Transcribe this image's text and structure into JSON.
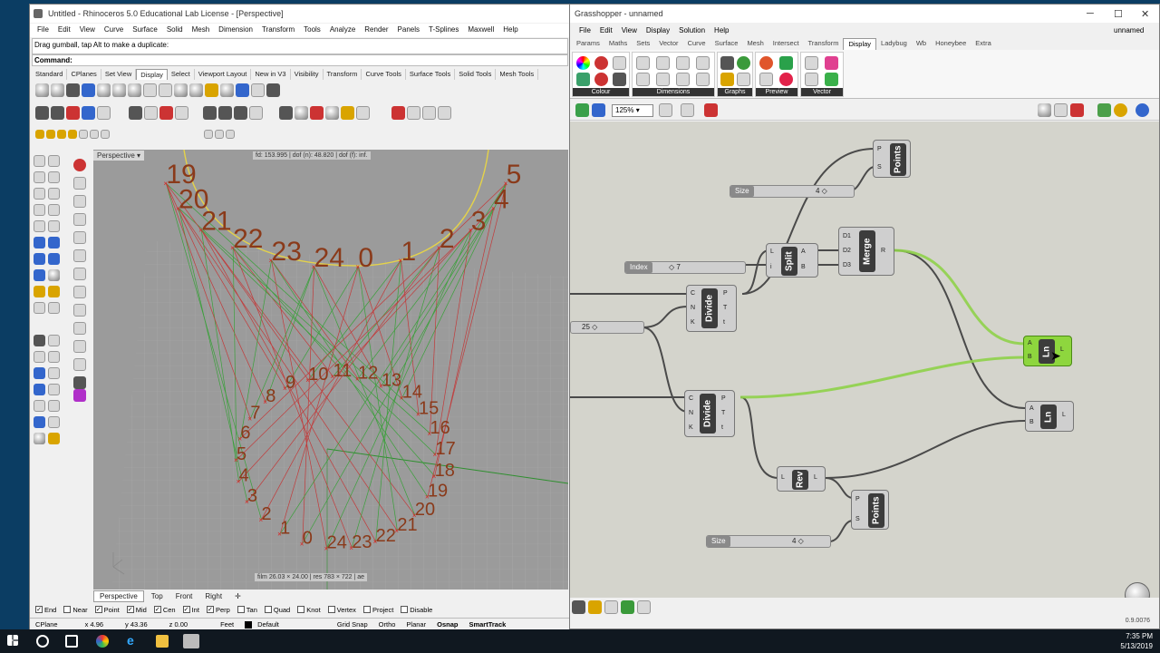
{
  "rhino": {
    "title": "Untitled - Rhinoceros 5.0 Educational Lab License - [Perspective]",
    "menu": [
      "File",
      "Edit",
      "View",
      "Curve",
      "Surface",
      "Solid",
      "Mesh",
      "Dimension",
      "Transform",
      "Tools",
      "Analyze",
      "Render",
      "Panels",
      "T-Splines",
      "Maxwell",
      "Help"
    ],
    "command_history": "Drag gumball, tap Alt to make a duplicate:",
    "command_prompt": "Command:",
    "toolbar_tabs": [
      "Standard",
      "CPlanes",
      "Set View",
      "Display",
      "Select",
      "Viewport Layout",
      "New in V3",
      "Visibility",
      "Transform",
      "Curve Tools",
      "Surface Tools",
      "Solid Tools",
      "Mesh Tools"
    ],
    "active_tab": "Display",
    "viewport_label": "Perspective",
    "camera_info": "fd: 153.995 | dof (n): 48.820 | dof (f): inf.",
    "film_info": "film 26.03 × 24.00 | res 783 × 722 | ae",
    "view_tabs": [
      "Perspective",
      "Top",
      "Front",
      "Right"
    ],
    "osnaps": [
      {
        "label": "End",
        "checked": true
      },
      {
        "label": "Near",
        "checked": false
      },
      {
        "label": "Point",
        "checked": true
      },
      {
        "label": "Mid",
        "checked": true
      },
      {
        "label": "Cen",
        "checked": true
      },
      {
        "label": "Int",
        "checked": true
      },
      {
        "label": "Perp",
        "checked": true
      },
      {
        "label": "Tan",
        "checked": false
      },
      {
        "label": "Quad",
        "checked": false
      },
      {
        "label": "Knot",
        "checked": false
      },
      {
        "label": "Vertex",
        "checked": false
      },
      {
        "label": "Project",
        "checked": false
      },
      {
        "label": "Disable",
        "checked": false
      }
    ],
    "status": {
      "cplane": "CPlane",
      "x": "x 4.96",
      "y": "y 43.36",
      "z": "z 0.00",
      "units": "Feet",
      "layer": "Default",
      "grid_snap": "Grid Snap",
      "ortho": "Ortho",
      "planar": "Planar",
      "osnap": "Osnap",
      "smarttrack": "SmartTrack"
    },
    "top_numbers": [
      "19",
      "20",
      "21",
      "22",
      "23",
      "24",
      "0",
      "1",
      "2",
      "3",
      "4",
      "5"
    ],
    "bottom_numbers": [
      "8",
      "9",
      "10",
      "11",
      "12",
      "13",
      "14",
      "15",
      "16",
      "17",
      "18",
      "19",
      "20",
      "21",
      "22",
      "23",
      "24",
      "0",
      "1",
      "2",
      "3",
      "4",
      "5",
      "6",
      "7"
    ]
  },
  "grasshopper": {
    "title": "Grasshopper - unnamed",
    "doc_name": "unnamed",
    "menu": [
      "File",
      "Edit",
      "View",
      "Display",
      "Solution",
      "Help"
    ],
    "tabs": [
      "Params",
      "Maths",
      "Sets",
      "Vector",
      "Curve",
      "Surface",
      "Mesh",
      "Intersect",
      "Transform",
      "Display",
      "Ladybug",
      "Wb",
      "Honeybee",
      "Extra"
    ],
    "active_tab": "Display",
    "ribbon_groups": [
      "Colour",
      "Dimensions",
      "Graphs",
      "Preview",
      "Vector"
    ],
    "zoom": "125%",
    "components": {
      "points_top": {
        "title": "Points",
        "inputs": [
          "P",
          "S"
        ]
      },
      "split": {
        "title": "Split",
        "inputs": [
          "L",
          "i"
        ],
        "outputs": [
          "A",
          "B"
        ]
      },
      "merge": {
        "title": "Merge",
        "inputs": [
          "D1",
          "D2",
          "D3"
        ],
        "outputs": [
          "R"
        ]
      },
      "divide_top": {
        "title": "Divide",
        "inputs": [
          "C",
          "N",
          "K"
        ],
        "outputs": [
          "P",
          "T",
          "t"
        ]
      },
      "divide_bottom": {
        "title": "Divide",
        "inputs": [
          "C",
          "N",
          "K"
        ],
        "outputs": [
          "P",
          "T",
          "t"
        ]
      },
      "line_green": {
        "title": "Ln",
        "inputs": [
          "A",
          "B"
        ],
        "outputs": [
          "L"
        ]
      },
      "line_grey": {
        "title": "Ln",
        "inputs": [
          "A",
          "B"
        ],
        "outputs": [
          "L"
        ]
      },
      "reverse": {
        "title": "Rev",
        "inputs": [
          "L"
        ],
        "outputs": [
          "L"
        ]
      },
      "points_bottom": {
        "title": "Points",
        "inputs": [
          "P",
          "S"
        ]
      }
    },
    "sliders": {
      "size_top": {
        "label": "Size",
        "value": "4"
      },
      "index": {
        "label": "Index",
        "value": "7"
      },
      "count": {
        "label": "",
        "value": "25"
      },
      "size_bottom": {
        "label": "Size",
        "value": "4"
      }
    },
    "version": "0.9.0076"
  },
  "taskbar": {
    "time": "7:35 PM",
    "date": "5/13/2019"
  }
}
